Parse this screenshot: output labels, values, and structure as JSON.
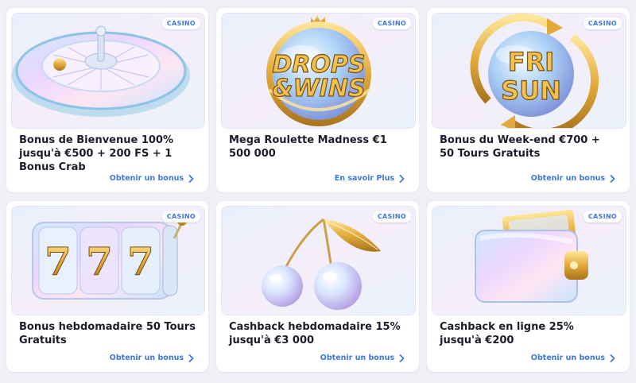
{
  "cards": [
    {
      "badge": "CASINO",
      "title": "Bonus de Bienvenue 100% jusqu'à €500 + 200 FS + 1 Bonus Crab",
      "action_label": "Obtenir un bonus",
      "image_icon": "roulette-wheel-icon"
    },
    {
      "badge": "CASINO",
      "title": "Mega Roulette Madness €1 500 000",
      "action_label": "En savoir Plus",
      "image_icon": "drops-and-wins-logo",
      "image_text": [
        "DROPS",
        "&WINS"
      ]
    },
    {
      "badge": "CASINO",
      "title": "Bonus du Week-end €700 + 50 Tours Gratuits",
      "action_label": "Obtenir un bonus",
      "image_icon": "fri-sun-logo",
      "image_text": [
        "FRI",
        "SUN"
      ]
    },
    {
      "badge": "CASINO",
      "title": "Bonus hebdomadaire 50 Tours Gratuits",
      "action_label": "Obtenir un bonus",
      "image_icon": "slot-reels-777-icon",
      "image_text": [
        "7",
        "7",
        "7"
      ]
    },
    {
      "badge": "CASINO",
      "title": "Cashback hebdomadaire 15% jusqu'à €3 000",
      "action_label": "Obtenir un bonus",
      "image_icon": "cherries-icon"
    },
    {
      "badge": "CASINO",
      "title": "Cashback en ligne 25% jusqu'à €200",
      "action_label": "Obtenir un bonus",
      "image_icon": "wallet-icon"
    }
  ],
  "colors": {
    "page_background": "#eef0f6",
    "card_background": "#ffffff",
    "accent_blue": "#3f78d8",
    "title_text": "#1b1d2b",
    "gold": "#d9a63a"
  }
}
